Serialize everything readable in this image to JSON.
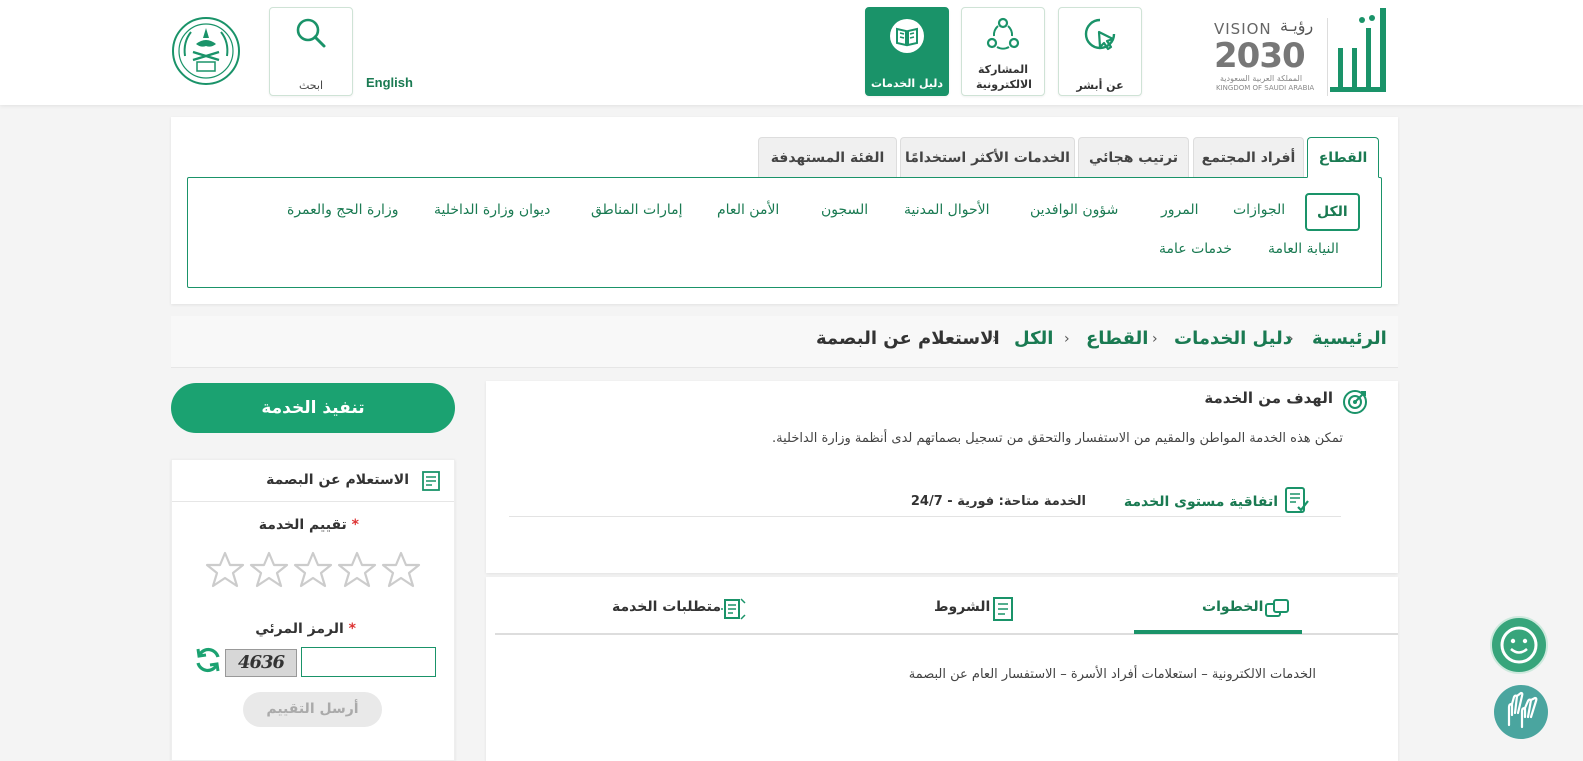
{
  "header": {
    "vision_word": "VISION",
    "vision_ar": "رؤيـة",
    "vision_year": "2030",
    "vision_country_ar": "المملكة العربية السعودية",
    "vision_country_en": "KINGDOM OF SAUDI ARABIA",
    "nav": [
      {
        "label": "عن أبشر",
        "icon": "cursor-click-icon"
      },
      {
        "label": "المشاركة الالكترونية",
        "icon": "share-nodes-icon"
      },
      {
        "label": "دليل الخدمات",
        "icon": "book-icon"
      }
    ],
    "search_label": "ابحث",
    "language_label": "English"
  },
  "sector_tabs": [
    "القطاع",
    "أفراد المجتمع",
    "ترتيب هجائي",
    "الخدمات الأكثر استخدامًا",
    "الفئة المستهدفة"
  ],
  "sector_filters": {
    "row1": [
      "الكل",
      "الجوازات",
      "المرور",
      "شؤون الوافدين",
      "الأحوال المدنية",
      "السجون",
      "الأمن العام",
      "إمارات المناطق",
      "ديوان وزارة الداخلية",
      "وزارة الحج والعمرة"
    ],
    "row2": [
      "النيابة العامة",
      "خدمات عامة"
    ]
  },
  "breadcrumb": [
    "الرئيسية",
    "دليل الخدمات",
    "القطاع",
    "الكل",
    "الاستعلام عن البصمة"
  ],
  "goal": {
    "title": "الهدف من الخدمة",
    "description": "تمكن هذه الخدمة المواطن والمقيم من الاستفسار والتحقق من تسجيل بصماتهم لدى أنظمة وزارة الداخلية.",
    "sla_label": "اتفاقية مستوى الخدمة",
    "sla_value": "الخدمة متاحة: فورية - 24/7"
  },
  "detail_tabs": {
    "steps": "الخطوات",
    "terms": "الشروط",
    "requirements": "متطلبات الخدمة",
    "steps_content": "الخدمات الالكترونية – استعلامات أفراد الأسرة – الاستفسار العام عن البصمة"
  },
  "sidebar": {
    "execute_label": "تنفيذ الخدمة",
    "card_title": "الاستعلام عن البصمة",
    "rating_label": "تقييم الخدمة",
    "captcha_label": "الرمز المرئي",
    "required_mark": "*",
    "captcha_text": "4636",
    "captcha_value": "",
    "send_label": "أرسل التقييم",
    "rating_value": 0,
    "rating_max": 5
  },
  "colors": {
    "brand": "#1a9369",
    "brand_dark": "#1a7a52",
    "execute": "#1ba271"
  }
}
